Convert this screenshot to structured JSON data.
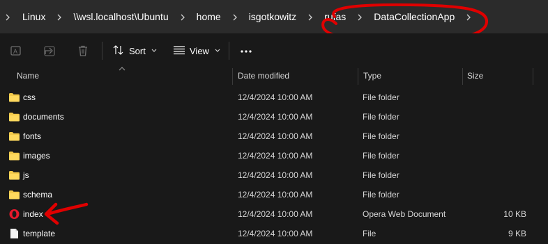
{
  "breadcrumb": {
    "items": [
      {
        "label": "Linux"
      },
      {
        "label": "\\\\wsl.localhost\\Ubuntu"
      },
      {
        "label": "home"
      },
      {
        "label": "isgotkowitz"
      },
      {
        "label": "rufas"
      },
      {
        "label": "DataCollectionApp"
      }
    ]
  },
  "toolbar": {
    "sort_label": "Sort",
    "view_label": "View",
    "icons": [
      "rename-icon",
      "share-icon",
      "delete-icon",
      "sort-icon",
      "view-icon",
      "more-icon"
    ]
  },
  "columns": {
    "name": "Name",
    "date": "Date modified",
    "type": "Type",
    "size": "Size"
  },
  "files": [
    {
      "name": "css",
      "date": "12/4/2024 10:00 AM",
      "type": "File folder",
      "size": "",
      "icon": "folder-icon"
    },
    {
      "name": "documents",
      "date": "12/4/2024 10:00 AM",
      "type": "File folder",
      "size": "",
      "icon": "folder-icon"
    },
    {
      "name": "fonts",
      "date": "12/4/2024 10:00 AM",
      "type": "File folder",
      "size": "",
      "icon": "folder-icon"
    },
    {
      "name": "images",
      "date": "12/4/2024 10:00 AM",
      "type": "File folder",
      "size": "",
      "icon": "folder-icon"
    },
    {
      "name": "js",
      "date": "12/4/2024 10:00 AM",
      "type": "File folder",
      "size": "",
      "icon": "folder-icon"
    },
    {
      "name": "schema",
      "date": "12/4/2024 10:00 AM",
      "type": "File folder",
      "size": "",
      "icon": "folder-icon"
    },
    {
      "name": "index",
      "date": "12/4/2024 10:00 AM",
      "type": "Opera Web Document",
      "size": "10 KB",
      "icon": "opera-icon"
    },
    {
      "name": "template",
      "date": "12/4/2024 10:00 AM",
      "type": "File",
      "size": "9 KB",
      "icon": "file-icon"
    }
  ],
  "colors": {
    "background": "#191919",
    "addressbar": "#2b2b2b",
    "folder": "#f3c94a",
    "annotation": "#e00000",
    "opera": "#e8192c"
  }
}
